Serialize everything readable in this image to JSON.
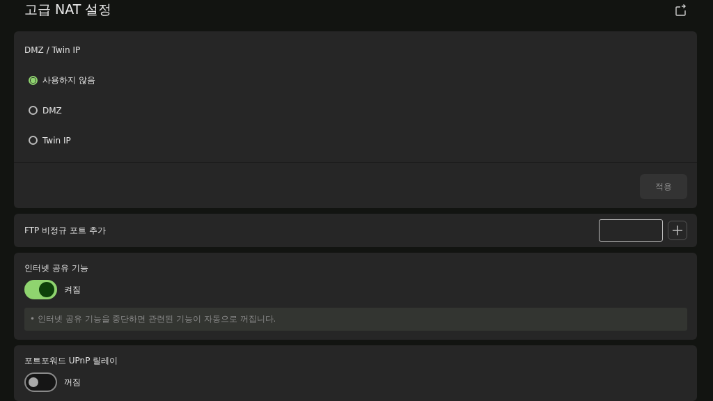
{
  "header": {
    "title": "고급 NAT 설정"
  },
  "dmz": {
    "label": "DMZ / Twin IP",
    "options": [
      {
        "label": "사용하지 않음",
        "selected": true
      },
      {
        "label": "DMZ",
        "selected": false
      },
      {
        "label": "Twin IP",
        "selected": false
      }
    ],
    "apply": {
      "label": "적용",
      "disabled": true
    }
  },
  "ftp": {
    "label": "FTP 비정규 포트 추가"
  },
  "toggles": [
    {
      "label": "인터넷 공유 기능",
      "on": true,
      "state_text": "켜짐",
      "notes": [
        "• 인터넷 공유 기능을 중단하면 관련된 기능이 자동으로 꺼집니다."
      ]
    },
    {
      "label": "포트포워드 UPnP 릴레이",
      "on": false,
      "state_text": "꺼짐"
    }
  ]
}
